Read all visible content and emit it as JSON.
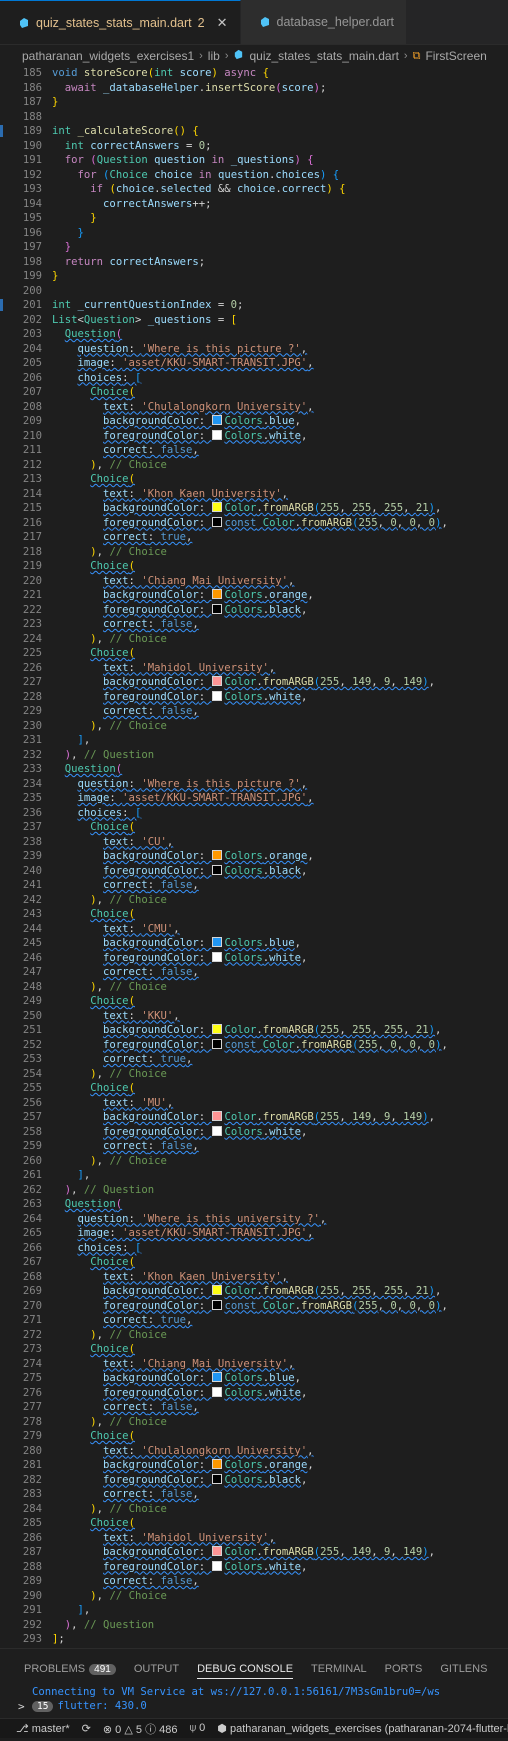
{
  "tabs": [
    {
      "label": "quiz_states_stats_main.dart",
      "badge": "2",
      "active": true
    },
    {
      "label": "database_helper.dart",
      "active": false
    }
  ],
  "breadcrumb": [
    "patharanan_widgets_exercises1",
    "lib",
    "quiz_states_stats_main.dart",
    "FirstScreen"
  ],
  "panel": {
    "tabs": [
      "PROBLEMS",
      "OUTPUT",
      "DEBUG CONSOLE",
      "TERMINAL",
      "PORTS",
      "GITLENS"
    ],
    "problems_count": "491",
    "console_line1": "Connecting to VM Service at ws://127.0.0.1:56161/7M3sGm1bru0=/ws",
    "console_count": "15",
    "console_line2": "flutter: 430.0",
    "prompt": ">"
  },
  "status": {
    "branch": "master*",
    "errors": "0",
    "warnings": "5",
    "info": "486",
    "ports": "0",
    "project": "patharanan_widgets_exercises (patharanan-2074-flutter-la"
  },
  "colors": {
    "blue": "#2196f3",
    "white": "#ffffff",
    "yellow": "#ffff15",
    "black": "#000000",
    "orange": "#ff9800",
    "purple": "#ff9595"
  },
  "first_line": 185
}
